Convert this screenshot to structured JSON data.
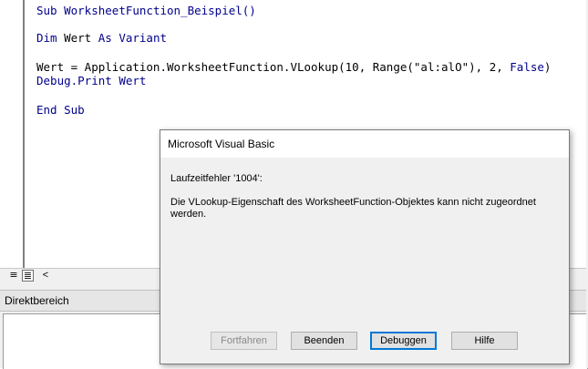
{
  "code": {
    "line1_kw": "Sub ",
    "line1_rest": "WorksheetFunction_Beispiel()",
    "line2_kw": "Dim ",
    "line2_mid": "Wert ",
    "line2_kw2": "As Variant",
    "line3_a": "Wert = Application.WorksheetFunction.VLookup(10, Range(\"al:alO\"), 2, ",
    "line3_kw": "False",
    "line3_end": ")",
    "line4_kw": "Debug.Print ",
    "line4_rest": "Wert",
    "line5_kw": "End Sub"
  },
  "panes": {
    "immediate_title": "Direktbereich"
  },
  "dialog": {
    "title": "Microsoft Visual Basic",
    "error_line": "Laufzeitfehler '1004':",
    "message": "Die VLookup-Eigenschaft des WorksheetFunction-Objektes kann nicht zugeordnet werden.",
    "buttons": {
      "continue": "Fortfahren",
      "end": "Beenden",
      "debug": "Debuggen",
      "help": "Hilfe"
    }
  },
  "icons": {
    "procedure_view": "procedure-view-icon",
    "full_module_view": "full-module-view-icon",
    "scroll_left": "scroll-left-icon"
  },
  "colors": {
    "keyword": "#00008b",
    "default_button_border": "#0078d7"
  }
}
